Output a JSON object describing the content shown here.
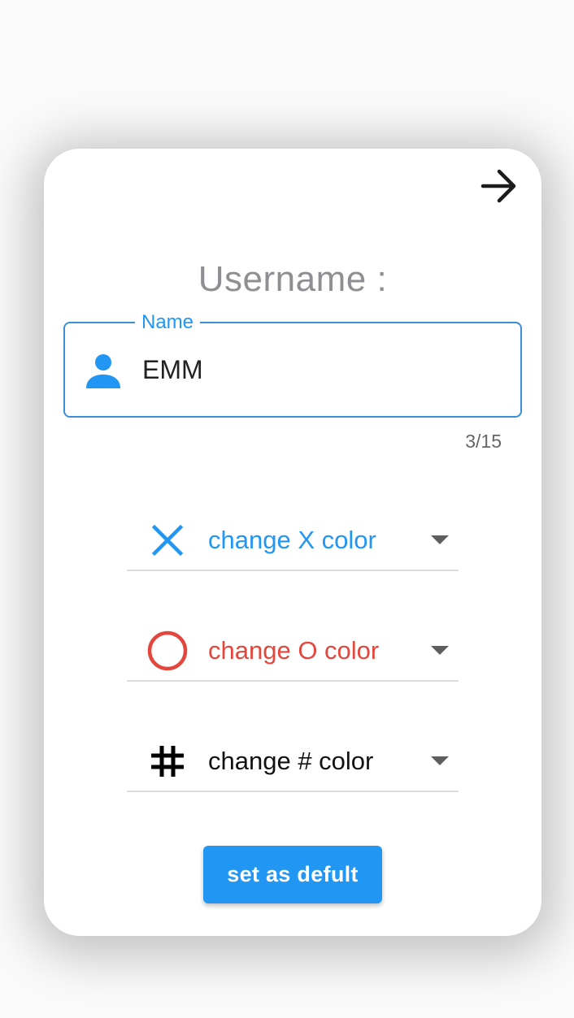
{
  "header": {
    "next_icon": "arrow-right-icon"
  },
  "username": {
    "title": "Username :",
    "field_label": "Name",
    "field_icon": "person-icon",
    "value": "EMM",
    "counter": "3/15"
  },
  "color_options": [
    {
      "icon": "x-icon",
      "label": "change X color",
      "color": "#2196f3"
    },
    {
      "icon": "circle-icon",
      "label": "change O color",
      "color": "#e2463c"
    },
    {
      "icon": "hash-icon",
      "label": "change # color",
      "color": "#000000"
    }
  ],
  "actions": {
    "default_label": "set as defult"
  },
  "colors": {
    "accent": "#2196f3",
    "o_color": "#e2463c",
    "hash_color": "#000000",
    "title_gray": "#8e8e93"
  }
}
